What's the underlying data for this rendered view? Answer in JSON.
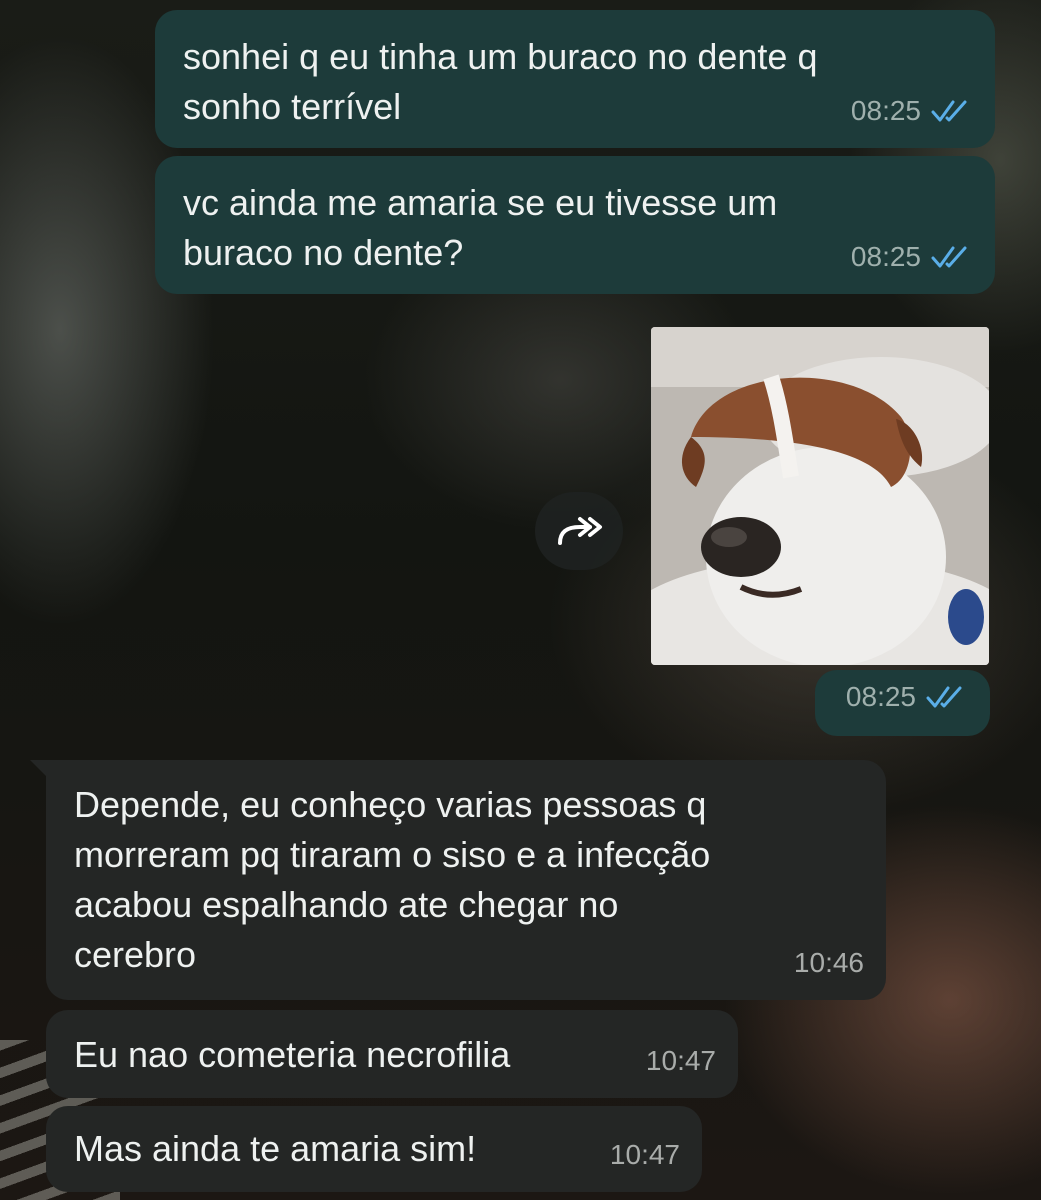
{
  "messages": [
    {
      "id": "m1",
      "direction": "out",
      "text": "sonhei q eu tinha um buraco no dente q\nsonho terrível",
      "time": "08:25",
      "status": "read"
    },
    {
      "id": "m2",
      "direction": "out",
      "text": "vc ainda me amaria se eu tivesse um\nburaco no dente?",
      "time": "08:25",
      "status": "read"
    },
    {
      "id": "m3",
      "direction": "out",
      "type": "image",
      "image_icon": "dog-gif-image",
      "time": "08:25",
      "status": "read"
    },
    {
      "id": "m4",
      "direction": "in",
      "text": "Depende, eu conheço varias pessoas q\nmorreram pq tiraram o siso e a infecção\nacabou espalhando ate chegar no\ncerebro",
      "time": "10:46"
    },
    {
      "id": "m5",
      "direction": "in",
      "text": "Eu nao cometeria necrofilia",
      "time": "10:47"
    },
    {
      "id": "m6",
      "direction": "in",
      "text": "Mas ainda te amaria sim!",
      "time": "10:47"
    }
  ],
  "icons": {
    "read_ticks": "double-check-icon",
    "forward": "forward-arrow-icon"
  },
  "colors": {
    "outgoing_bubble": "#1d3b3a",
    "incoming_bubble": "#242625",
    "read_ticks": "#5aaee8"
  }
}
